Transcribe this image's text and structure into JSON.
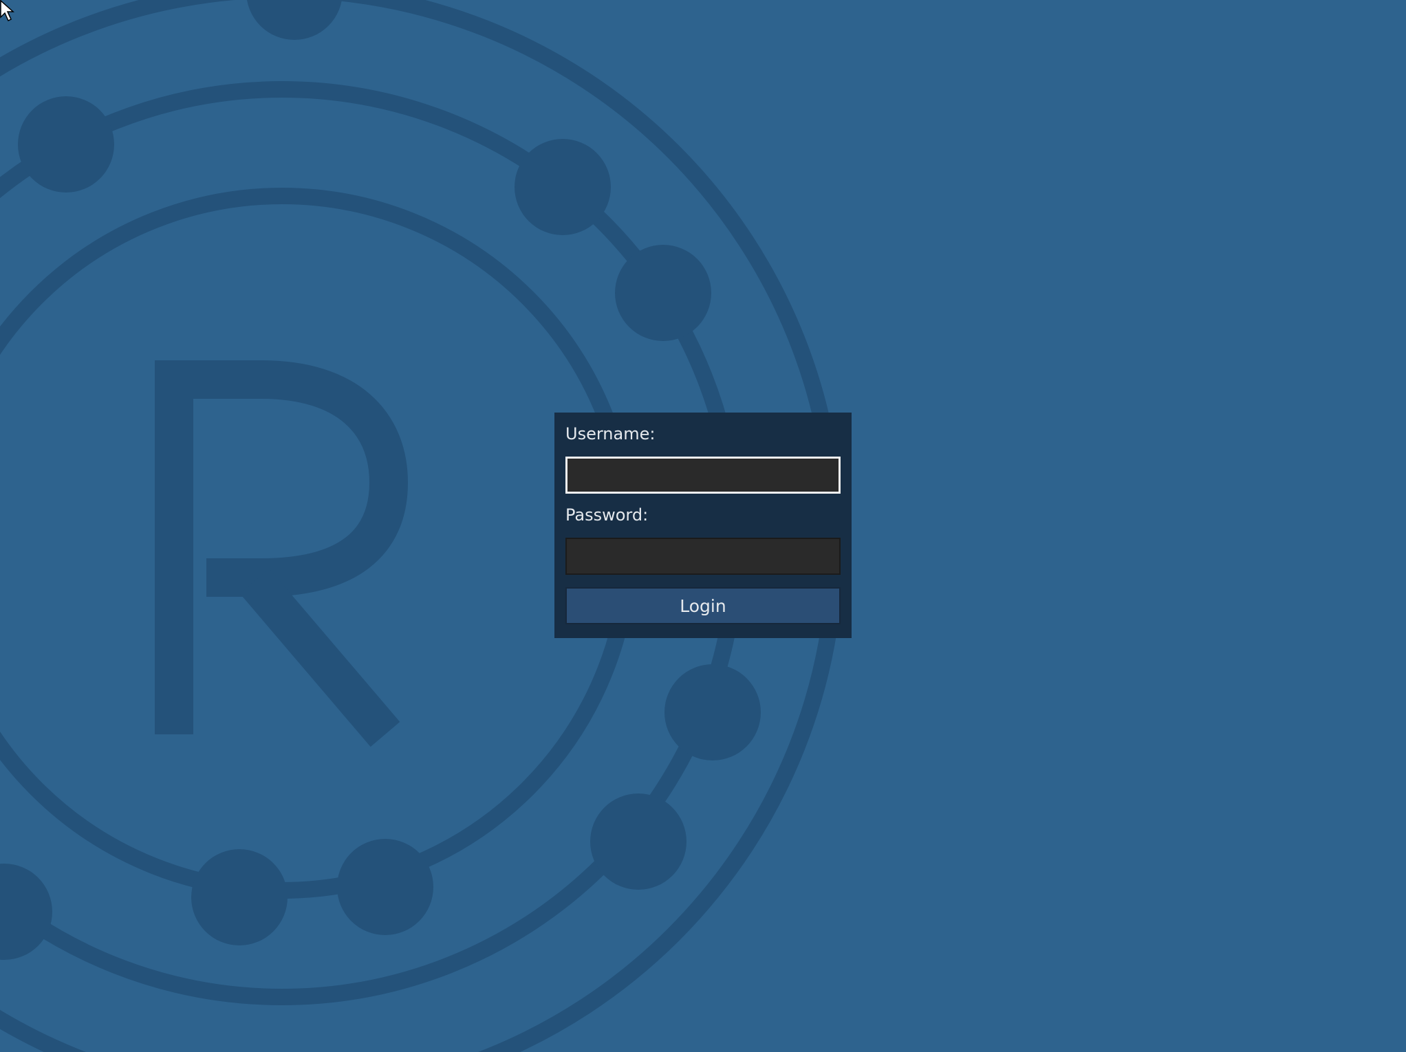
{
  "background": {
    "color": "#2e638e",
    "logo_color": "#24527a",
    "logo_icon": "r-ring-logo"
  },
  "login": {
    "username_label": "Username:",
    "username_value": "",
    "password_label": "Password:",
    "password_value": "",
    "login_button_label": "Login"
  },
  "cursor": {
    "icon": "arrow-cursor"
  }
}
